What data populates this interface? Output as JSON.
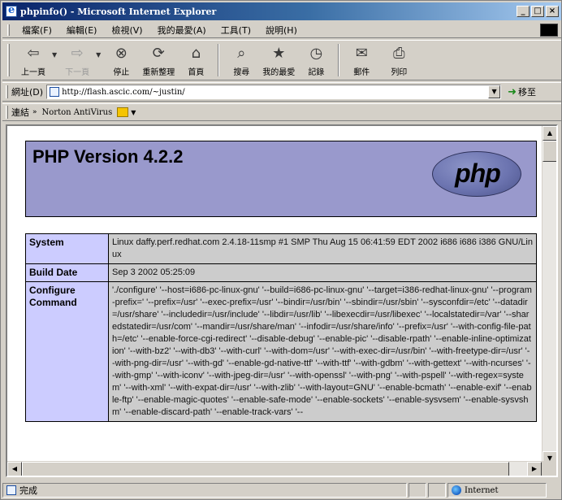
{
  "window": {
    "title": "phpinfo() - Microsoft Internet Explorer",
    "controls": [
      "_",
      "□",
      "×"
    ]
  },
  "menu": [
    "檔案(F)",
    "編輯(E)",
    "檢視(V)",
    "我的最愛(A)",
    "工具(T)",
    "說明(H)"
  ],
  "toolbar": {
    "back": "上一頁",
    "forward": "下一頁",
    "stop": "停止",
    "refresh": "重新整理",
    "home": "首頁",
    "search": "搜尋",
    "favorites": "我的最愛",
    "history": "記錄",
    "mail": "郵件",
    "print": "列印"
  },
  "address": {
    "label": "網址(D)",
    "url": "http://flash.ascic.com/~justin/",
    "go": "移至"
  },
  "links": {
    "label": "連結",
    "chevron": "»",
    "item": "Norton AntiVirus"
  },
  "page": {
    "version": "PHP Version 4.2.2",
    "logo": "php",
    "rows": [
      {
        "key": "System",
        "value": "Linux daffy.perf.redhat.com 2.4.18-11smp #1 SMP Thu Aug 15 06:41:59 EDT 2002 i686 i686 i386 GNU/Linux"
      },
      {
        "key": "Build Date",
        "value": "Sep 3 2002 05:25:09"
      },
      {
        "key": "Configure Command",
        "value": "'./configure' '--host=i686-pc-linux-gnu' '--build=i686-pc-linux-gnu' '--target=i386-redhat-linux-gnu' '--program-prefix=' '--prefix=/usr' '--exec-prefix=/usr' '--bindir=/usr/bin' '--sbindir=/usr/sbin' '--sysconfdir=/etc' '--datadir=/usr/share' '--includedir=/usr/include' '--libdir=/usr/lib' '--libexecdir=/usr/libexec' '--localstatedir=/var' '--sharedstatedir=/usr/com' '--mandir=/usr/share/man' '--infodir=/usr/share/info' '--prefix=/usr' '--with-config-file-path=/etc' '--enable-force-cgi-redirect' '--disable-debug' '--enable-pic' '--disable-rpath' '--enable-inline-optimization' '--with-bz2' '--with-db3' '--with-curl' '--with-dom=/usr' '--with-exec-dir=/usr/bin' '--with-freetype-dir=/usr' '--with-png-dir=/usr' '--with-gd' '--enable-gd-native-ttf' '--with-ttf' '--with-gdbm' '--with-gettext' '--with-ncurses' '--with-gmp' '--with-iconv' '--with-jpeg-dir=/usr' '--with-openssl' '--with-png' '--with-pspell' '--with-regex=system' '--with-xml' '--with-expat-dir=/usr' '--with-zlib' '--with-layout=GNU' '--enable-bcmath' '--enable-exif' '--enable-ftp' '--enable-magic-quotes' '--enable-safe-mode' '--enable-sockets' '--enable-sysvsem' '--enable-sysvshm' '--enable-discard-path' '--enable-track-vars' '--"
      }
    ]
  },
  "status": {
    "text": "完成",
    "zone": "Internet"
  },
  "icons": {
    "back": "back-arrow-icon",
    "forward": "forward-arrow-icon",
    "stop": "stop-icon",
    "refresh": "refresh-icon",
    "home": "home-icon",
    "search": "search-icon",
    "favorites": "favorites-icon",
    "history": "history-icon",
    "mail": "mail-icon",
    "print": "print-icon"
  },
  "colors": {
    "title_gradient_start": "#0a246a",
    "php_header_bg": "#9999cc",
    "table_key_bg": "#ccccff",
    "table_value_bg": "#cccccc"
  }
}
